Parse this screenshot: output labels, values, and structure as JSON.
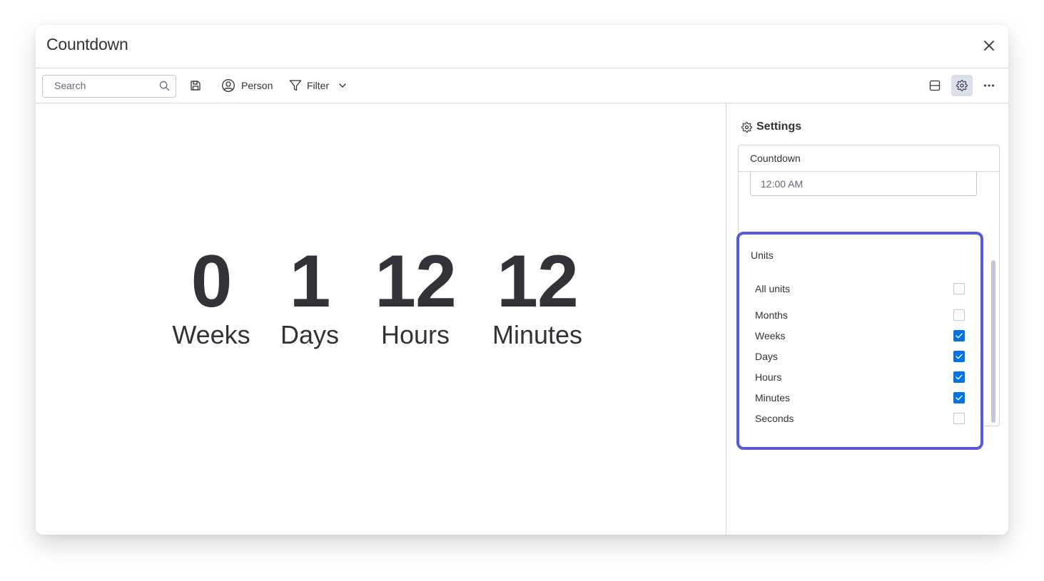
{
  "window": {
    "title": "Countdown"
  },
  "toolbar": {
    "search_placeholder": "Search",
    "person_label": "Person",
    "filter_label": "Filter"
  },
  "countdown": {
    "units": [
      {
        "value": "0",
        "label": "Weeks"
      },
      {
        "value": "1",
        "label": "Days"
      },
      {
        "value": "12",
        "label": "Hours"
      },
      {
        "value": "12",
        "label": "Minutes"
      }
    ]
  },
  "settings": {
    "header": "Settings",
    "panel_title": "Countdown",
    "time_value": "12:00 AM",
    "units_title": "Units",
    "unit_options": [
      {
        "label": "All units",
        "checked": false
      },
      {
        "label": "Months",
        "checked": false
      },
      {
        "label": "Weeks",
        "checked": true
      },
      {
        "label": "Days",
        "checked": true
      },
      {
        "label": "Hours",
        "checked": true
      },
      {
        "label": "Minutes",
        "checked": true
      },
      {
        "label": "Seconds",
        "checked": false
      }
    ]
  },
  "colors": {
    "text": "#323338",
    "checkbox_checked": "#0073ea",
    "highlight_border": "#5559df",
    "active_button_bg": "#dcdfec",
    "divider": "#d0d4e4"
  }
}
